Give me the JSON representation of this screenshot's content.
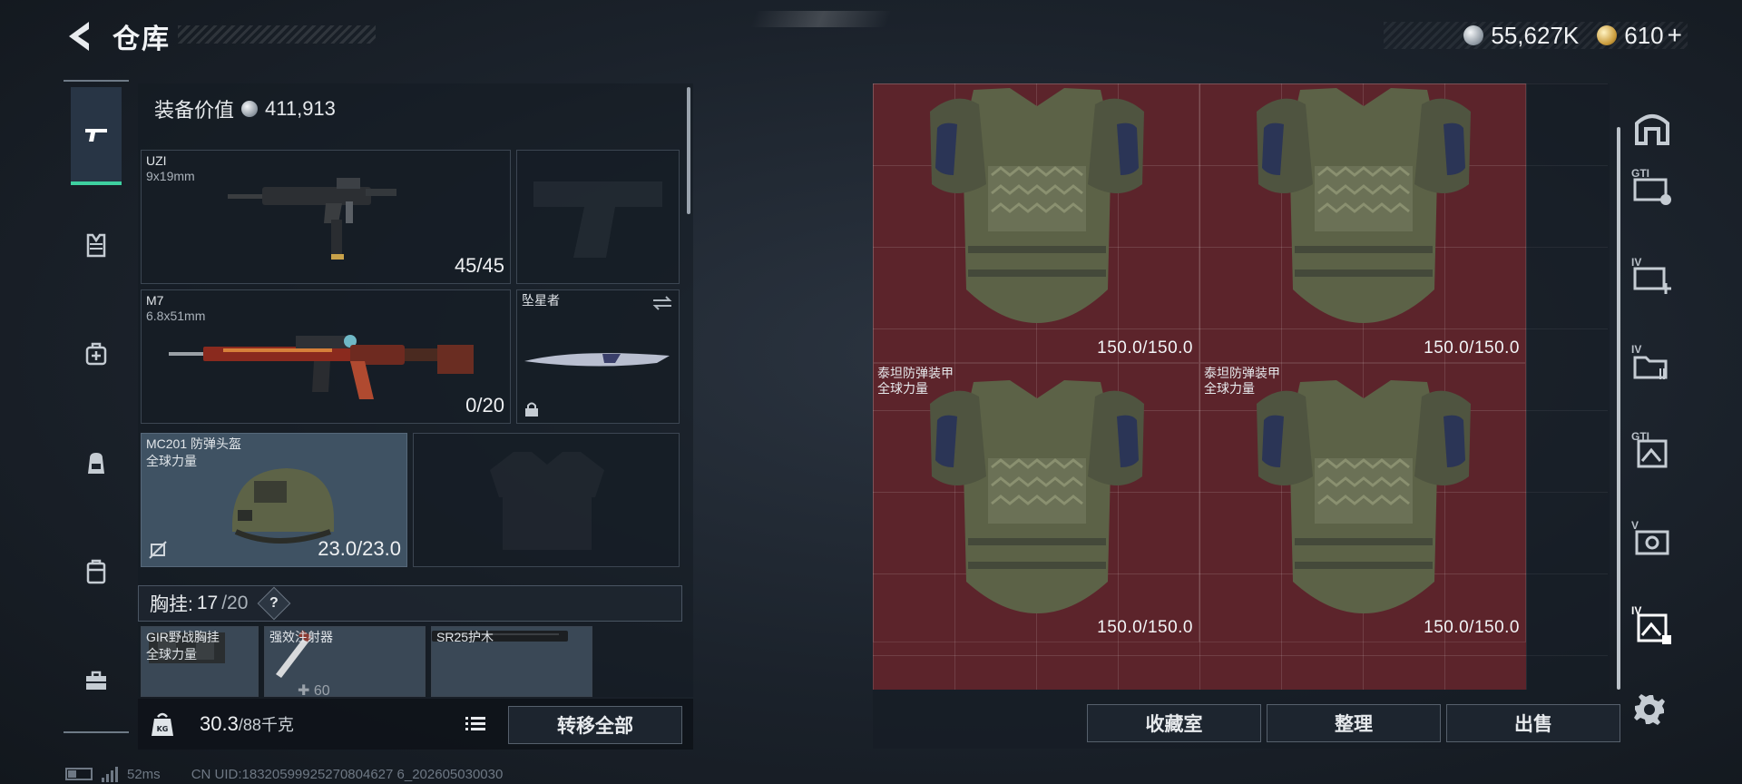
{
  "header": {
    "title": "仓库",
    "silver_value": "55,627K",
    "gold_value": "610",
    "gold_plus": "+"
  },
  "equipment": {
    "value_label": "装备价值",
    "value": "411,913",
    "slots": {
      "primary": {
        "name": "UZI",
        "caliber": "9x19mm",
        "ammo": "45/45"
      },
      "secondary": {
        "name": "M7",
        "caliber": "6.8x51mm",
        "ammo": "0/20"
      },
      "melee": {
        "name": "坠星者"
      },
      "helmet": {
        "name": "MC201 防弹头盔",
        "brand": "全球力量",
        "durability": "23.0/23.0"
      }
    },
    "vest": {
      "label": "胸挂:",
      "used": "17",
      "capacity": "/20",
      "help": "?"
    },
    "vest_items": [
      {
        "name": "GIR野战胸挂",
        "brand": "全球力量"
      },
      {
        "name": "强效注射器",
        "count": "60"
      },
      {
        "name": "SR25护木"
      }
    ]
  },
  "weight": {
    "current": "30.3",
    "max": "/88千克",
    "transfer_label": "转移全部"
  },
  "footer": {
    "ping": "52ms",
    "uid": "CN UID:18320599925270804627 6_202605030030"
  },
  "stash": {
    "items": [
      {
        "name": "",
        "brand": "",
        "durability": "150.0/150.0"
      },
      {
        "name": "",
        "brand": "",
        "durability": "150.0/150.0"
      },
      {
        "name": "泰坦防弹装甲",
        "brand": "全球力量",
        "durability": "150.0/150.0"
      },
      {
        "name": "泰坦防弹装甲",
        "brand": "全球力量",
        "durability": "150.0/150.0"
      }
    ],
    "buttons": {
      "collection": "收藏室",
      "organize": "整理",
      "sell": "出售"
    }
  },
  "right_tabs": [
    {
      "icon": "stash-home-icon",
      "level": ""
    },
    {
      "icon": "tab-g-icon",
      "level": "GTI"
    },
    {
      "icon": "tab-iv-plus-icon",
      "level": "IV"
    },
    {
      "icon": "tab-iv-folder-icon",
      "level": "IV"
    },
    {
      "icon": "tab-g-image-icon",
      "level": "GTI"
    },
    {
      "icon": "tab-v-camera-icon",
      "level": "V"
    },
    {
      "icon": "tab-iv-active-icon",
      "level": "IV"
    }
  ],
  "colors": {
    "accent": "#3ed0a0",
    "stash_cell": "#5c242b",
    "helmet_slot": "#3f5263"
  }
}
